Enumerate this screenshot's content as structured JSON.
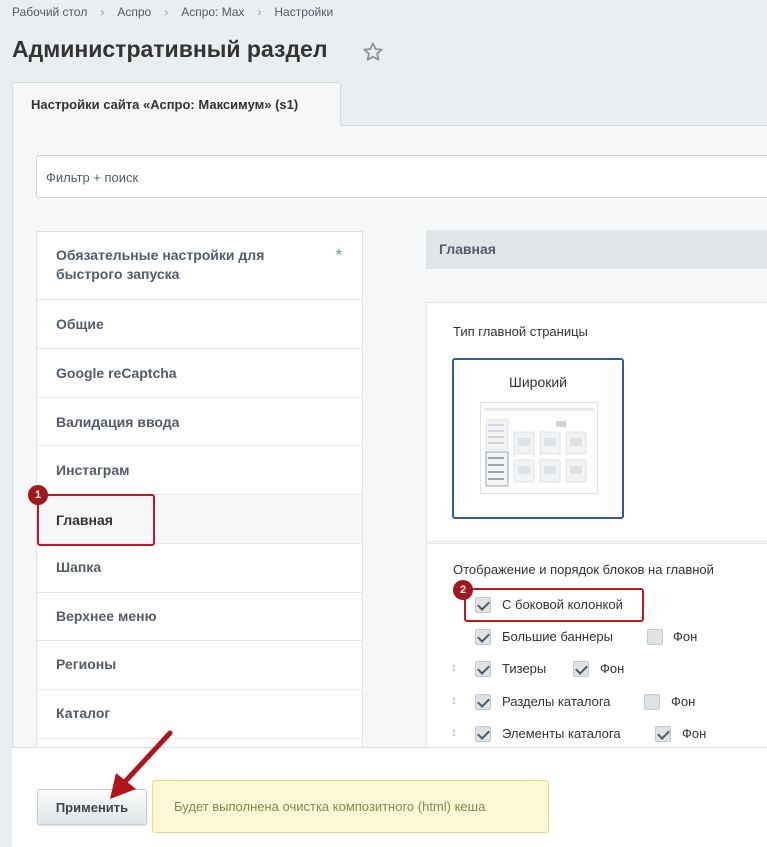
{
  "breadcrumb": [
    "Рабочий стол",
    "Аспро",
    "Аспро: Max",
    "Настройки"
  ],
  "page": {
    "title": "Административный раздел"
  },
  "tab": {
    "label": "Настройки сайта «Аспро: Максимум» (s1)"
  },
  "filter": {
    "placeholder": "Фильтр + поиск"
  },
  "sidebar": {
    "items": [
      {
        "label": "Обязательные настройки для быстрого запуска",
        "asterisk": "*"
      },
      {
        "label": "Общие"
      },
      {
        "label": "Google reCaptcha"
      },
      {
        "label": "Валидация ввода"
      },
      {
        "label": "Инстаграм"
      },
      {
        "label": "Главная",
        "selected": true
      },
      {
        "label": "Шапка"
      },
      {
        "label": "Верхнее меню"
      },
      {
        "label": "Регионы"
      },
      {
        "label": "Каталог"
      }
    ]
  },
  "main": {
    "section_title": "Главная",
    "page_type": {
      "label": "Тип главной страницы",
      "selected_type": "Широкий"
    },
    "blocks": {
      "label": "Отображение и порядок блоков на главной",
      "items": [
        {
          "label": "С боковой колонкой",
          "checked": true
        },
        {
          "label": "Большие баннеры",
          "checked": true,
          "bg_label": "Фон",
          "bg_checked": false
        },
        {
          "label": "Тизеры",
          "checked": true,
          "bg_label": "Фон",
          "bg_checked": true
        },
        {
          "label": "Разделы каталога",
          "checked": true,
          "bg_label": "Фон",
          "bg_checked": false
        },
        {
          "label": "Элементы каталога",
          "checked": true,
          "bg_label": "Фон",
          "bg_checked": true
        }
      ]
    }
  },
  "footer": {
    "apply_label": "Применить",
    "notice": "Будет выполнена очистка композитного (html) кеша"
  },
  "annotations": [
    "1",
    "2"
  ],
  "colors": {
    "annotation_red": "#bb1a22",
    "selected_border": "#2f5e9e"
  }
}
